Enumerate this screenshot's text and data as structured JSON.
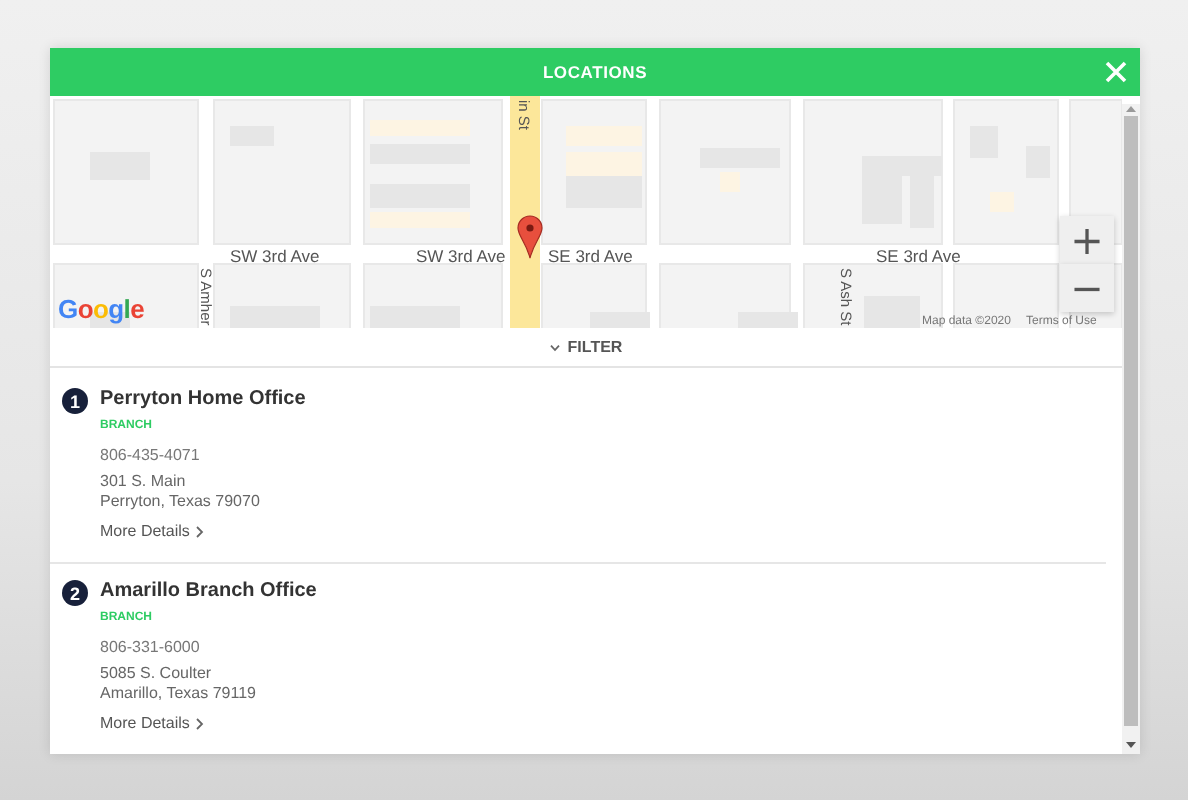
{
  "header": {
    "title": "LOCATIONS"
  },
  "map": {
    "street_labels": [
      {
        "text": "in St",
        "kind": "vertical"
      },
      {
        "text": "SW 3rd Ave",
        "kind": "horizontal"
      },
      {
        "text": "SW 3rd Ave",
        "kind": "horizontal"
      },
      {
        "text": "SE 3rd Ave",
        "kind": "horizontal"
      },
      {
        "text": "SE 3rd Ave",
        "kind": "horizontal"
      },
      {
        "text": "S Amher",
        "kind": "vertical"
      },
      {
        "text": "S Ash St",
        "kind": "vertical"
      }
    ],
    "logo": "Google",
    "attribution": "Map data ©2020",
    "terms": "Terms of Use",
    "zoom_in": "+",
    "zoom_out": "−"
  },
  "filter": {
    "label": "FILTER"
  },
  "locations": [
    {
      "number": "1",
      "name": "Perryton Home Office",
      "type": "BRANCH",
      "phone": "806-435-4071",
      "address_lines": [
        "301 S. Main",
        "Perryton, Texas 79070"
      ],
      "link": "More Details"
    },
    {
      "number": "2",
      "name": "Amarillo Branch Office",
      "type": "BRANCH",
      "phone": "806-331-6000",
      "address_lines": [
        "5085 S. Coulter",
        "Amarillo, Texas 79119"
      ],
      "link": "More Details"
    }
  ]
}
